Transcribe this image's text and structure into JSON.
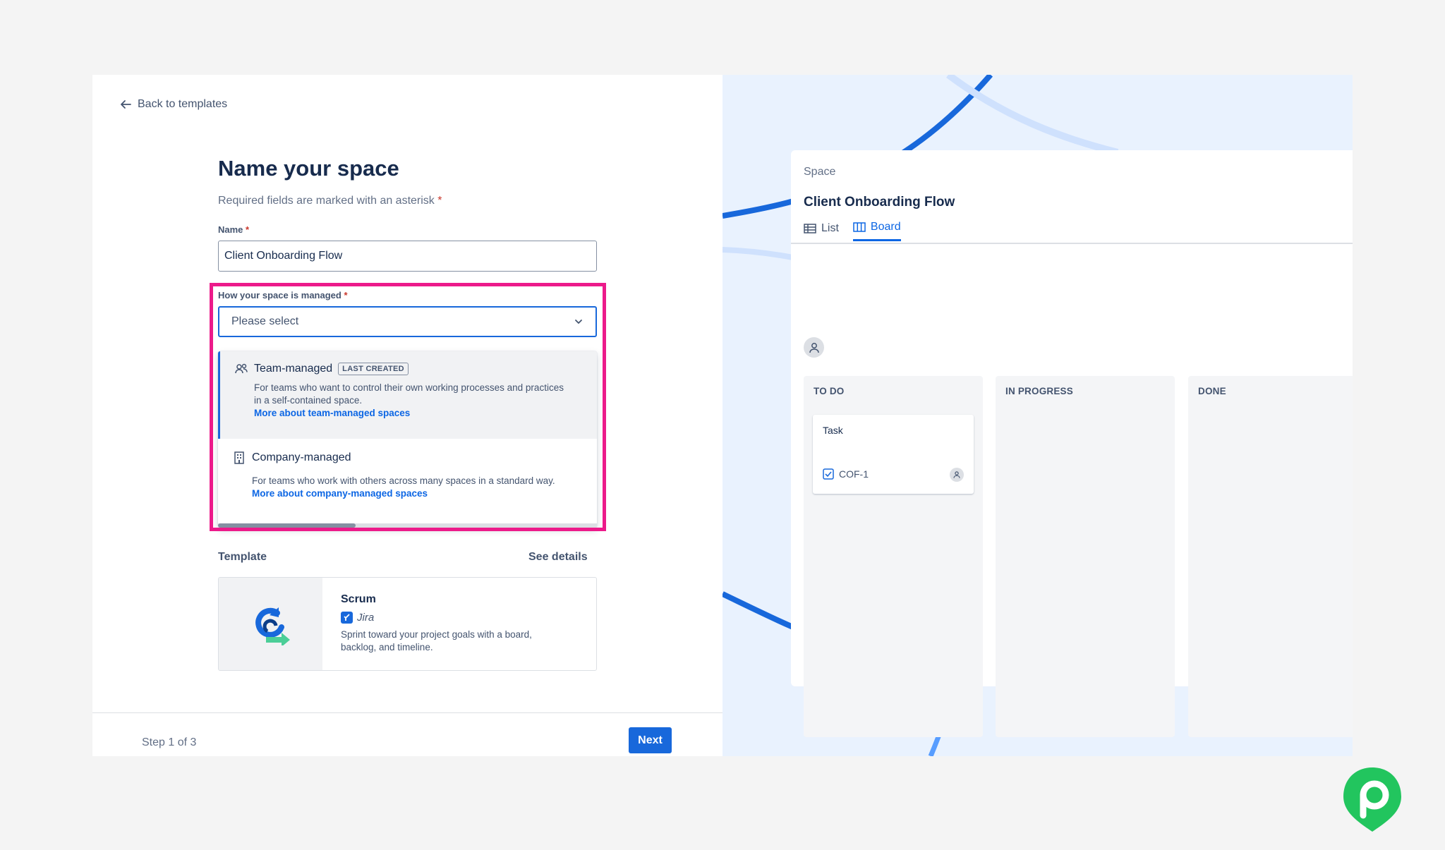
{
  "form": {
    "back_label": "Back to templates",
    "title": "Name your space",
    "required_note": "Required fields are marked with an asterisk",
    "required_mark": "*",
    "name_label": "Name",
    "name_value": "Client Onboarding Flow",
    "managed_label": "How your space is managed",
    "select_placeholder": "Please select",
    "options": [
      {
        "title": "Team-managed",
        "badge": "LAST CREATED",
        "description": "For teams who want to control their own working processes and practices in a self-contained space.",
        "link": "More about team-managed spaces",
        "icon": "people-icon"
      },
      {
        "title": "Company-managed",
        "description": "For teams who work with others across many spaces in a standard way.",
        "link": "More about company-managed spaces",
        "icon": "building-icon"
      }
    ],
    "template_label": "Template",
    "see_details": "See details",
    "template": {
      "name": "Scrum",
      "app": "Jira",
      "description": "Sprint toward your project goals with a board, backlog, and timeline."
    },
    "step": "Step 1 of 3",
    "next_label": "Next"
  },
  "preview": {
    "crumb": "Space",
    "title": "Client Onboarding Flow",
    "tabs": [
      {
        "label": "List",
        "icon": "table-icon"
      },
      {
        "label": "Board",
        "icon": "board-icon",
        "active": true
      }
    ],
    "columns": [
      {
        "title": "TO DO"
      },
      {
        "title": "IN PROGRESS"
      },
      {
        "title": "DONE"
      }
    ],
    "task": {
      "title": "Task",
      "key": "COF-1"
    }
  },
  "colors": {
    "primary": "#1868db",
    "highlight": "#ec1a8a",
    "brand": "#22c55e"
  }
}
